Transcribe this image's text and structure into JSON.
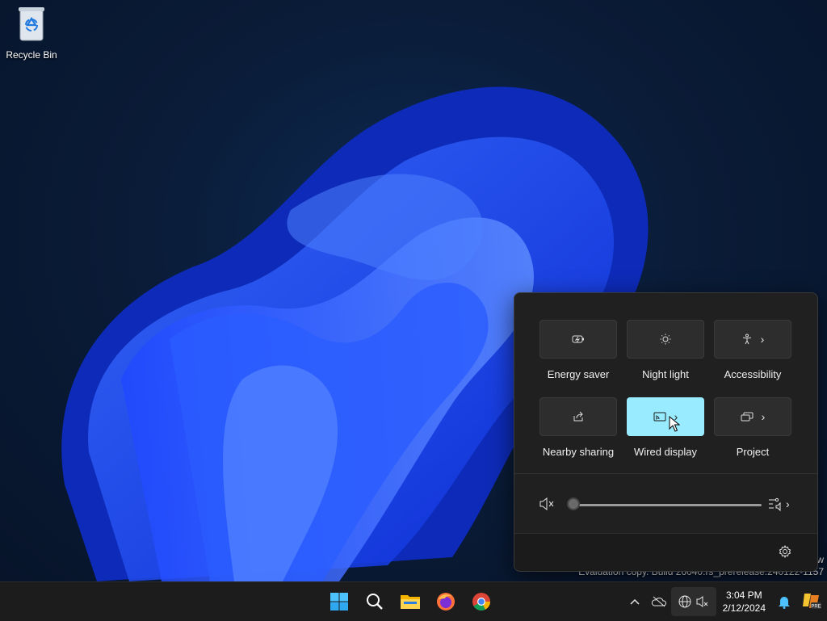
{
  "desktop": {
    "recycle_bin_label": "Recycle Bin",
    "watermark_line1": "w",
    "watermark_line2": "Evaluation copy. Build 26040.rs_prerelease.240122-1157"
  },
  "quick_settings": {
    "tiles": [
      {
        "label": "Energy saver",
        "icon": "energy-saver-icon",
        "active": false,
        "has_chevron": false
      },
      {
        "label": "Night light",
        "icon": "night-light-icon",
        "active": false,
        "has_chevron": false
      },
      {
        "label": "Accessibility",
        "icon": "accessibility-icon",
        "active": false,
        "has_chevron": true
      },
      {
        "label": "Nearby sharing",
        "icon": "share-icon",
        "active": false,
        "has_chevron": false
      },
      {
        "label": "Wired display",
        "icon": "cast-icon",
        "active": true,
        "has_chevron": true
      },
      {
        "label": "Project",
        "icon": "project-icon",
        "active": false,
        "has_chevron": true
      }
    ],
    "volume": {
      "muted": true,
      "level": 0
    },
    "active_color": "#99ebff"
  },
  "taskbar": {
    "pinned": [
      "start-icon",
      "search-icon",
      "file-explorer-icon",
      "firefox-icon",
      "chrome-icon"
    ],
    "clock": {
      "time": "3:04 PM",
      "date": "2/12/2024"
    }
  }
}
